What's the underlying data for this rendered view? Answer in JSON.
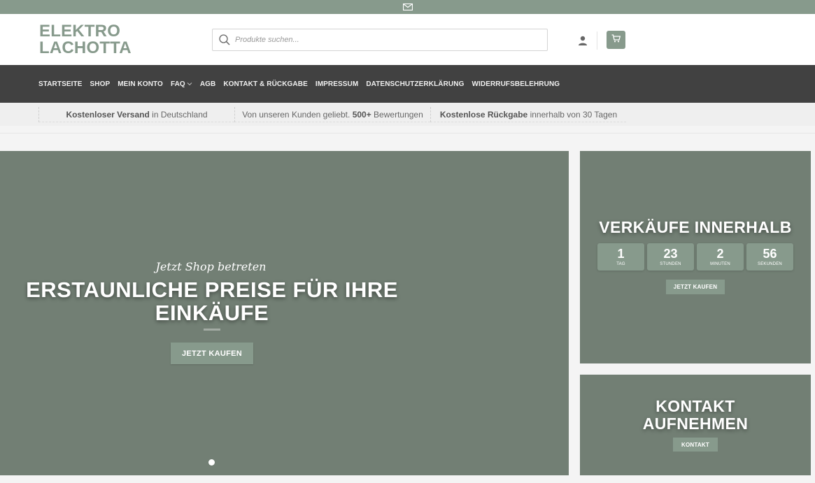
{
  "colors": {
    "accent": "#879a8c",
    "nav_bg": "#414141",
    "tile_bg": "#727f74"
  },
  "topbar": {
    "icon": "mail-icon"
  },
  "header": {
    "logo_line1": "ELEKTRO",
    "logo_line2": "LACHOTTA",
    "search_placeholder": "Produkte suchen...",
    "icons": [
      "search-icon",
      "user-icon",
      "cart-icon"
    ]
  },
  "nav": {
    "items": [
      {
        "label": "STARTSEITE"
      },
      {
        "label": "SHOP"
      },
      {
        "label": "MEIN KONTO"
      },
      {
        "label": "FAQ"
      },
      {
        "label": "AGB"
      },
      {
        "label": "KONTAKT & RÜCKGABE"
      },
      {
        "label": "IMPRESSUM"
      },
      {
        "label": "DATENSCHUTZERKLÄRUNG"
      },
      {
        "label": "WIDERRUFSBELEHRUNG"
      }
    ]
  },
  "usp": [
    {
      "bold": "Kostenloser Versand",
      "rest": " in Deutschland"
    },
    {
      "pre": "Von unseren Kunden geliebt. ",
      "bold": "500+",
      "rest": " Bewertungen"
    },
    {
      "bold": "Kostenlose Rückgabe",
      "rest": " innerhalb von 30 Tagen"
    }
  ],
  "hero": {
    "kicker": "Jetzt Shop betreten",
    "title": "ERSTAUNLICHE PREISE FÜR IHRE EINKÄUFE",
    "button": "JETZT KAUFEN"
  },
  "countdown": {
    "title": "VERKÄUFE INNERHALB",
    "units": [
      {
        "value": "1",
        "label": "TAG"
      },
      {
        "value": "23",
        "label": "STUNDEN"
      },
      {
        "value": "2",
        "label": "MINUTEN"
      },
      {
        "value": "56",
        "label": "SEKUNDEN"
      }
    ],
    "button": "JETZT KAUFEN"
  },
  "contact": {
    "title_line1": "KONTAKT",
    "title_line2": "AUFNEHMEN",
    "button": "KONTAKT"
  }
}
